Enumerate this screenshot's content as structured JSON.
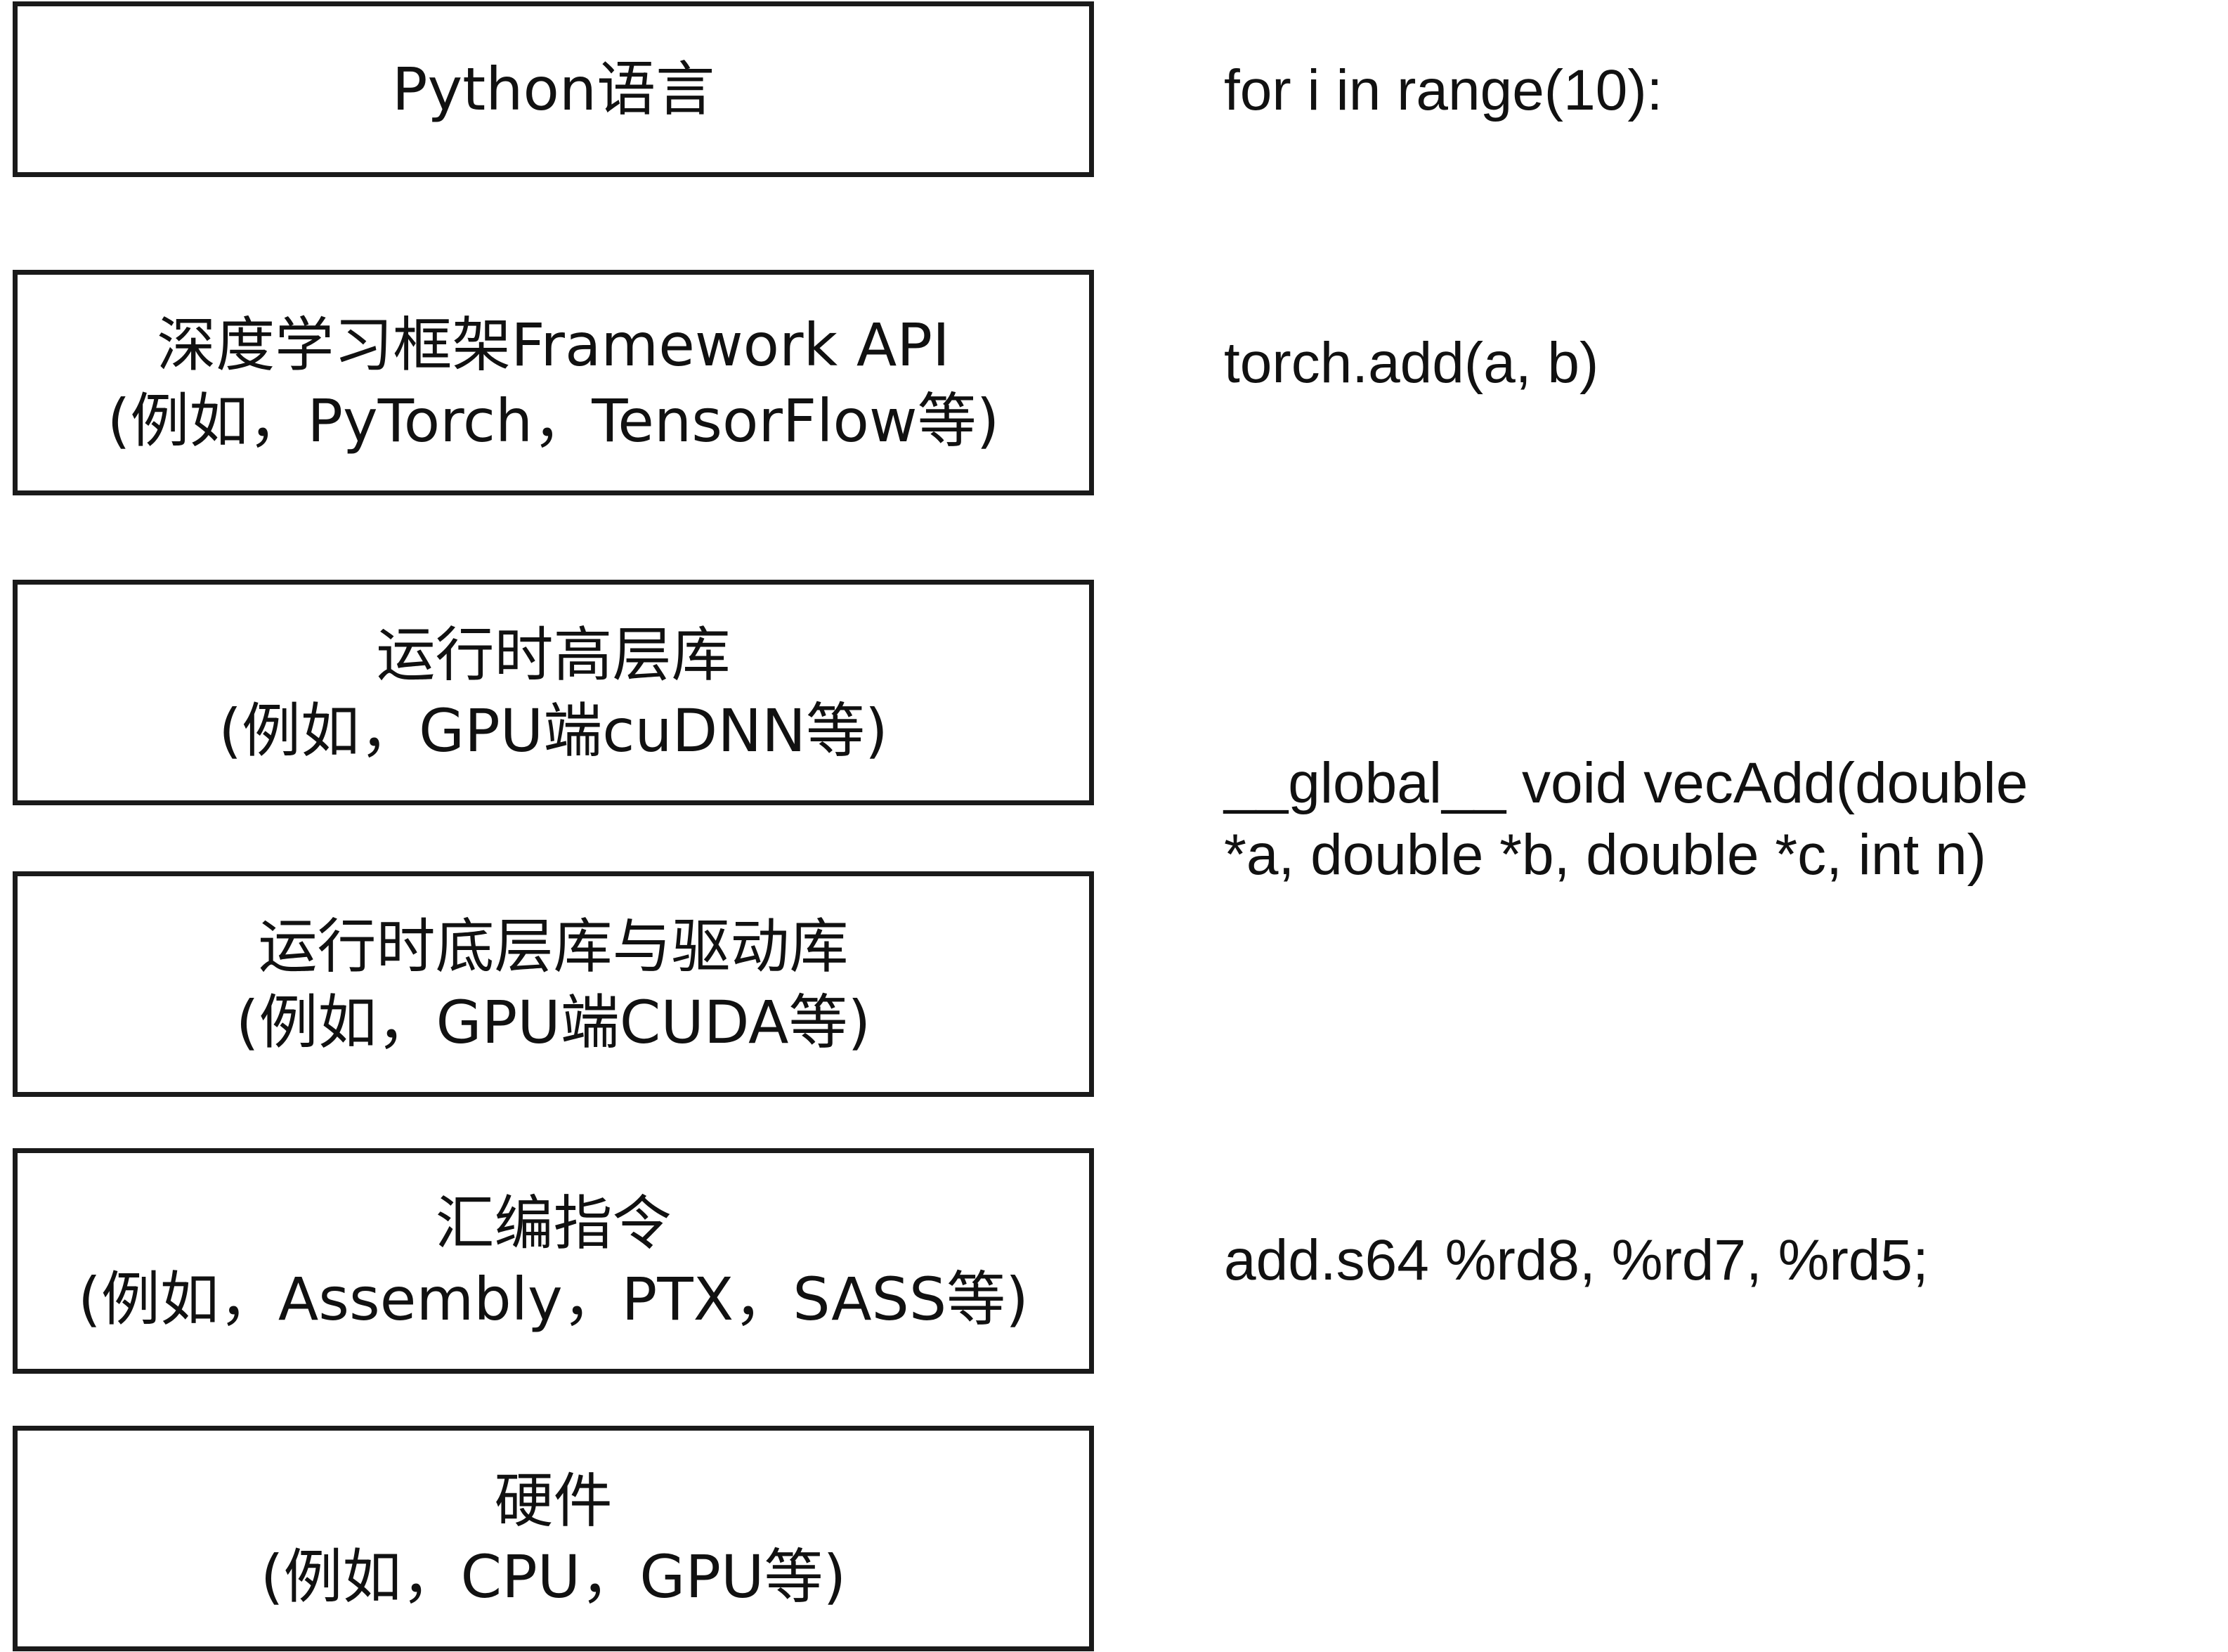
{
  "layers": [
    {
      "title": "Python语言",
      "subtitle": ""
    },
    {
      "title": "深度学习框架Framework API",
      "subtitle": "(例如，PyTorch，TensorFlow等)"
    },
    {
      "title": "运行时高层库",
      "subtitle": "(例如，GPU端cuDNN等)"
    },
    {
      "title": "运行时底层库与驱动库",
      "subtitle": "(例如，GPU端CUDA等)"
    },
    {
      "title": "汇编指令",
      "subtitle": "(例如，Assembly，PTX，SASS等)"
    },
    {
      "title": "硬件",
      "subtitle": "(例如，CPU，GPU等)"
    }
  ],
  "code_examples": [
    {
      "lines": [
        "for i in range(10):"
      ]
    },
    {
      "lines": [
        "torch.add(a, b)"
      ]
    },
    {
      "lines": [
        "__global__ void vecAdd(double",
        "*a, double *b, double *c, int n)"
      ]
    },
    {
      "lines": [
        "add.s64 %rd8, %rd7, %rd5;"
      ]
    }
  ]
}
